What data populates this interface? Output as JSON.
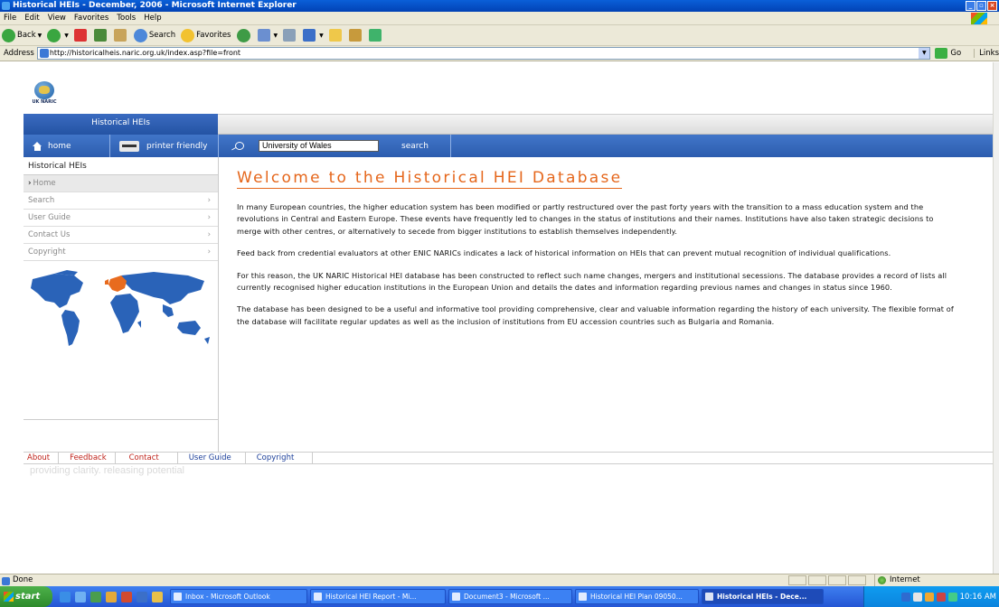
{
  "window": {
    "title": "Historical HEIs - December, 2006 - Microsoft Internet Explorer"
  },
  "menu": [
    "File",
    "Edit",
    "View",
    "Favorites",
    "Tools",
    "Help"
  ],
  "toolbar": {
    "back": "Back",
    "search": "Search",
    "favorites": "Favorites"
  },
  "address": {
    "label": "Address",
    "url": "http://historicalheis.naric.org.uk/index.asp?file=front",
    "go": "Go",
    "links": "Links"
  },
  "site": {
    "logo_text": "UK NARIC",
    "section_tab": "Historical HEIs",
    "nav": {
      "home": "home",
      "printer": "printer friendly",
      "search_value": "University of Wales",
      "search_button": "search"
    },
    "sidebar": {
      "heading": "Historical HEIs",
      "items": [
        {
          "label": "Home",
          "active": true
        },
        {
          "label": "Search"
        },
        {
          "label": "User Guide"
        },
        {
          "label": "Contact Us"
        },
        {
          "label": "Copyright"
        }
      ]
    },
    "main": {
      "heading": "Welcome to the Historical HEI Database",
      "paragraphs": [
        "In many European countries, the higher education system has been modified or partly restructured over the past forty years with the transition to a mass education system and the revolutions in Central and Eastern Europe. These events have frequently led to changes in the status of institutions and their names. Institutions have also taken strategic decisions to merge with other centres, or alternatively to secede from bigger institutions to establish themselves independently.",
        "Feed back from credential evaluators at other ENIC NARICs indicates a lack of historical information on HEIs that can prevent mutual recognition of individual qualifications.",
        "For this reason, the UK NARIC Historical HEI database has been constructed to reflect such name changes, mergers and institutional secessions. The database provides a record of lists all currently recognised higher education institutions in the European Union and details the dates and information regarding previous names and changes in status since 1960.",
        "The database has been designed to be a useful and informative tool providing comprehensive, clear and valuable information regarding the history of each university. The flexible format of the database will facilitate regular updates as well as the inclusion of institutions from EU accession countries such as Bulgaria and Romania."
      ]
    },
    "footer": {
      "about": "About",
      "feedback": "Feedback",
      "contact": "Contact",
      "user_guide": "User Guide",
      "copyright": "Copyright"
    },
    "tagline": "providing clarity. releasing potential"
  },
  "status": {
    "text": "Done",
    "zone": "Internet"
  },
  "taskbar": {
    "start": "start",
    "tasks": [
      "Inbox - Microsoft Outlook",
      "Historical HEI Report - Mi...",
      "Document3 - Microsoft ...",
      "Historical HEI Plan 09050...",
      "Historical HEIs - Dece..."
    ],
    "clock": "10:16 AM"
  },
  "colors": {
    "accent_orange": "#e5661b",
    "nav_blue": "#2c5cae",
    "footer_red": "#c0231b"
  }
}
